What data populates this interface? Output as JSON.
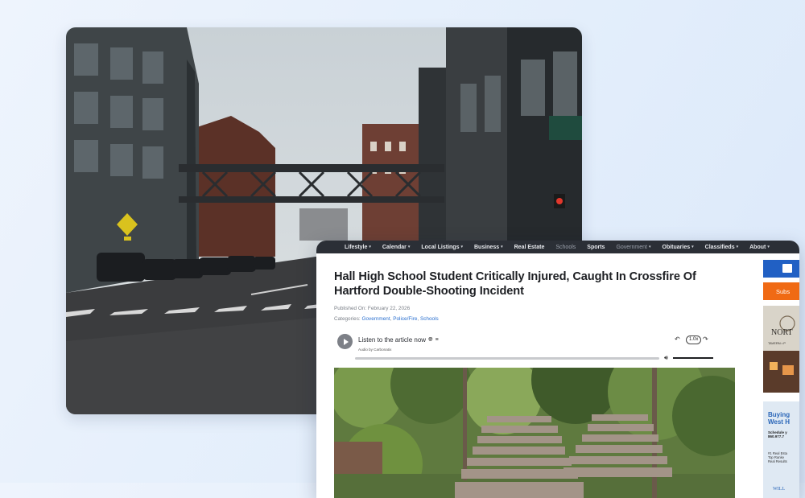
{
  "nav": {
    "items": [
      {
        "label": "Lifestyle",
        "has_menu": true
      },
      {
        "label": "Calendar",
        "has_menu": true
      },
      {
        "label": "Local Listings",
        "has_menu": true
      },
      {
        "label": "Business",
        "has_menu": true
      },
      {
        "label": "Real Estate",
        "has_menu": false
      },
      {
        "label": "Schools",
        "has_menu": false
      },
      {
        "label": "Sports",
        "has_menu": false
      },
      {
        "label": "Government",
        "has_menu": true
      },
      {
        "label": "Obituaries",
        "has_menu": true
      },
      {
        "label": "Classifieds",
        "has_menu": true
      },
      {
        "label": "About",
        "has_menu": true
      }
    ],
    "chevron": "▾"
  },
  "article": {
    "title": "Hall High School Student Critically Injured, Caught In Crossfire Of Hartford Double-Shooting Incident",
    "published": "Published On: February 22, 2026",
    "categories_label": "Categories:",
    "categories": [
      "Government",
      "Police/Fire",
      "Schools"
    ]
  },
  "audio": {
    "listen_label": "Listen to the article now",
    "audio_by": "Audio by Carbonatix",
    "speed": "1.0x",
    "progress": 0
  },
  "sidebar": {
    "subscribe_label": "Subs",
    "ad_title": "NORT",
    "ad2_title_1": "Buying",
    "ad2_title_2": "West H",
    "ad2_line1": "Schedule y",
    "ad2_line2": "860.977.7",
    "ad2_line3": "#1 Real Esta",
    "ad2_line4": "Top Ranke",
    "ad2_line5": "Real Results",
    "ad2_footer": "WILL",
    "ad_sub": "TAVERN • P"
  },
  "colors": {
    "nav_bg": "#2b2f36",
    "link": "#2a6fcf",
    "subscribe_button": "#f06a14",
    "sidebar_button": "#2160c4"
  },
  "icons": [
    "play-icon",
    "globe-icon",
    "list-icon",
    "rewind-icon",
    "forward-icon",
    "volume-icon"
  ]
}
